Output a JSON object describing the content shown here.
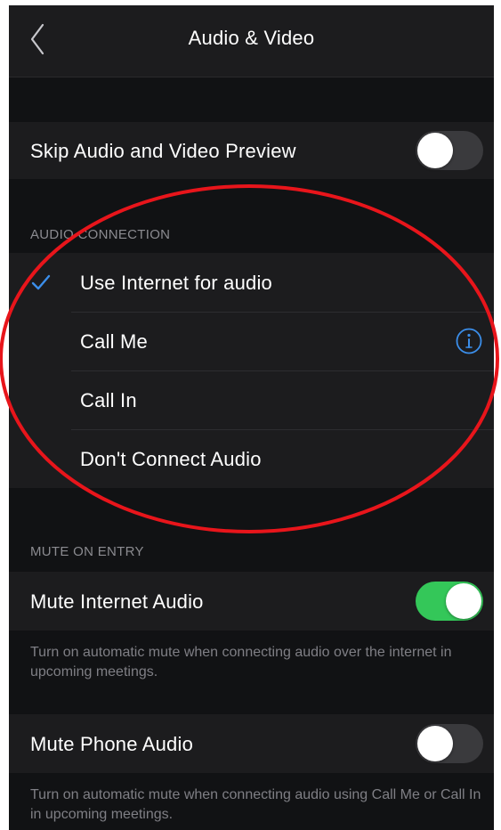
{
  "navbar": {
    "title": "Audio & Video",
    "back_icon": "chevron-left-icon"
  },
  "skip_preview": {
    "label": "Skip Audio and Video Preview",
    "enabled": false
  },
  "audio_connection": {
    "header": "AUDIO CONNECTION",
    "options": [
      {
        "label": "Use Internet for audio",
        "selected": true
      },
      {
        "label": "Call Me",
        "selected": false,
        "info_icon": "info-circle-icon"
      },
      {
        "label": "Call In",
        "selected": false
      },
      {
        "label": "Don't Connect Audio",
        "selected": false
      }
    ]
  },
  "mute_on_entry": {
    "header": "MUTE ON ENTRY",
    "internet_audio": {
      "label": "Mute Internet Audio",
      "enabled": true,
      "note": "Turn on automatic mute when connecting audio over the internet in upcoming meetings."
    },
    "phone_audio": {
      "label": "Mute Phone Audio",
      "enabled": false,
      "note": "Turn on automatic mute when connecting audio using Call Me or Call In in upcoming meetings."
    }
  },
  "colors": {
    "accent_blue": "#3b8eea",
    "toggle_on": "#34c759",
    "annotation_red": "#e8151b"
  }
}
